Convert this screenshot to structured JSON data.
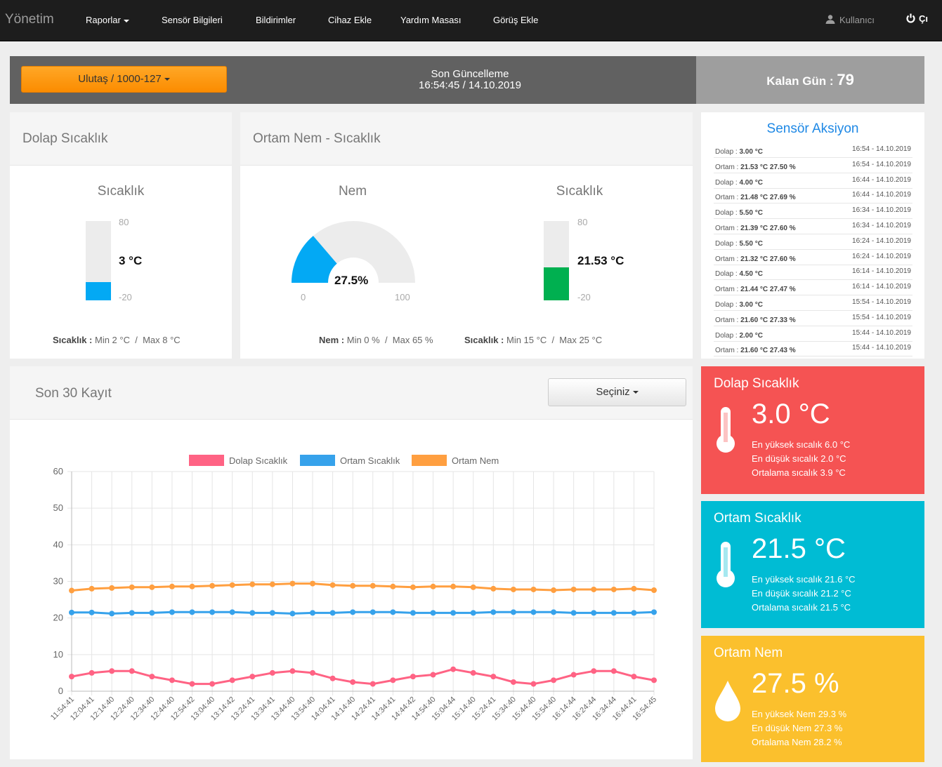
{
  "nav": {
    "brand": "Yönetim",
    "items": [
      "Raporlar",
      "Sensör Bilgileri",
      "Bildirimler",
      "Cihaz Ekle",
      "Yardım Masası",
      "Görüş Ekle"
    ],
    "user": "Kullanıcı",
    "logout": "Çı"
  },
  "topbar": {
    "device": "Ulutaş / 1000-127",
    "update_label": "Son Güncelleme",
    "update_time": "16:54:45 / 14.10.2019",
    "days_label": "Kalan Gün :",
    "days_value": "79"
  },
  "dolap_panel": {
    "title": "Dolap Sıcaklık",
    "gauge_title": "Sıcaklık",
    "value": "3 °C",
    "level": 0.23,
    "max": "80",
    "min": "-20",
    "minmax": {
      "label": "Sıcaklık :",
      "min": "Min 2 °C",
      "max": "Max 8 °C"
    }
  },
  "ortam_panel": {
    "title": "Ortam Nem - Sıcaklık",
    "nem": {
      "title": "Nem",
      "value": "27.5%",
      "fraction": 0.275,
      "min": "0",
      "max": "100",
      "minmax": {
        "label": "Nem :",
        "min": "Min 0 %",
        "max": "Max 65 %"
      }
    },
    "sicaklik": {
      "title": "Sıcaklık",
      "value": "21.53 °C",
      "level": 0.415,
      "max": "80",
      "min": "-20",
      "minmax": {
        "label": "Sıcaklık :",
        "min": "Min 15 °C",
        "max": "Max 25 °C"
      }
    }
  },
  "actions": {
    "title": "Sensör Aksiyon",
    "rows": [
      {
        "label": "Dolap :",
        "value": "3.00 °C",
        "time": "16:54 - 14.10.2019"
      },
      {
        "label": "Ortam :",
        "value": "21.53 °C 27.50 %",
        "time": "16:54 - 14.10.2019"
      },
      {
        "label": "Dolap :",
        "value": "4.00 °C",
        "time": "16:44 - 14.10.2019"
      },
      {
        "label": "Ortam :",
        "value": "21.48 °C 27.69 %",
        "time": "16:44 - 14.10.2019"
      },
      {
        "label": "Dolap :",
        "value": "5.50 °C",
        "time": "16:34 - 14.10.2019"
      },
      {
        "label": "Ortam :",
        "value": "21.39 °C 27.60 %",
        "time": "16:34 - 14.10.2019"
      },
      {
        "label": "Dolap :",
        "value": "5.50 °C",
        "time": "16:24 - 14.10.2019"
      },
      {
        "label": "Ortam :",
        "value": "21.32 °C 27.60 %",
        "time": "16:24 - 14.10.2019"
      },
      {
        "label": "Dolap :",
        "value": "4.50 °C",
        "time": "16:14 - 14.10.2019"
      },
      {
        "label": "Ortam :",
        "value": "21.44 °C 27.47 %",
        "time": "16:14 - 14.10.2019"
      },
      {
        "label": "Dolap :",
        "value": "3.00 °C",
        "time": "15:54 - 14.10.2019"
      },
      {
        "label": "Ortam :",
        "value": "21.60 °C 27.33 %",
        "time": "15:54 - 14.10.2019"
      },
      {
        "label": "Dolap :",
        "value": "2.00 °C",
        "time": "15:44 - 14.10.2019"
      },
      {
        "label": "Ortam :",
        "value": "21.60 °C 27.43 %",
        "time": "15:44 - 14.10.2019"
      }
    ]
  },
  "cards": {
    "dolap": {
      "title": "Dolap Sıcaklık",
      "value": "3.0 °C",
      "stats": [
        "En yüksek sıcalık  6.0 °C",
        "En düşük sıcalık   2.0 °C",
        "Ortalama sıcalık   3.9 °C"
      ],
      "color": "#f55353",
      "icon": "thermometer-icon"
    },
    "ortam": {
      "title": "Ortam Sıcaklık",
      "value": "21.5 °C",
      "stats": [
        "En yüksek sıcalık  21.6 °C",
        "En düşük sıcalık   21.2 °C",
        "Ortalama sıcalık   21.5 °C"
      ],
      "color": "#00bcd4",
      "icon": "thermometer-icon"
    },
    "nem": {
      "title": "Ortam Nem",
      "value": "27.5 %",
      "stats": [
        "En yüksek Nem  29.3 %",
        "En düşük Nem   27.3 %",
        "Ortalama Nem   28.2 %"
      ],
      "color": "#fbc02d",
      "icon": "water-drop-icon"
    }
  },
  "chart_panel": {
    "title": "Son 30 Kayıt",
    "select_label": "Seçiniz"
  },
  "chart_data": {
    "type": "line",
    "categories": [
      "11:54:41",
      "12:04:41",
      "12:14:40",
      "12:24:40",
      "12:34:40",
      "12:44:40",
      "12:54:42",
      "13:04:40",
      "13:14:42",
      "13:24:41",
      "13:34:41",
      "13:44:40",
      "13:54:40",
      "14:04:41",
      "14:14:40",
      "14:24:41",
      "14:34:41",
      "14:44:42",
      "14:54:40",
      "15:04:44",
      "15:14:40",
      "15:24:41",
      "15:34:40",
      "15:44:40",
      "15:54:40",
      "16:14:44",
      "16:24:44",
      "16:34:44",
      "16:44:41",
      "16:54:45"
    ],
    "series": [
      {
        "name": "Dolap Sıcaklık",
        "color": "#ff6384",
        "values": [
          4,
          5,
          5.5,
          5.5,
          4,
          3,
          2,
          2,
          3,
          4,
          5,
          5.5,
          5,
          3.5,
          2.5,
          2,
          3,
          4,
          4.5,
          6,
          5,
          4,
          2.5,
          2,
          3,
          4.5,
          5.5,
          5.5,
          4,
          3
        ]
      },
      {
        "name": "Ortam Sıcaklık",
        "color": "#36a2eb",
        "values": [
          21.5,
          21.5,
          21.2,
          21.4,
          21.4,
          21.6,
          21.6,
          21.6,
          21.6,
          21.4,
          21.4,
          21.2,
          21.4,
          21.4,
          21.6,
          21.6,
          21.6,
          21.4,
          21.4,
          21.4,
          21.4,
          21.6,
          21.6,
          21.6,
          21.6,
          21.4,
          21.4,
          21.4,
          21.4,
          21.6
        ]
      },
      {
        "name": "Ortam Nem",
        "color": "#ff9f40",
        "values": [
          27.5,
          28,
          28.2,
          28.4,
          28.4,
          28.6,
          28.6,
          28.8,
          29,
          29.2,
          29.2,
          29.4,
          29.4,
          29,
          28.8,
          28.8,
          28.6,
          28.4,
          28.6,
          28.6,
          28.4,
          28,
          27.8,
          27.8,
          27.6,
          27.8,
          27.8,
          27.8,
          28,
          27.6
        ]
      }
    ],
    "ylim": [
      0,
      60
    ],
    "yticks": [
      0,
      10,
      20,
      30,
      40,
      50,
      60
    ],
    "legend": "top",
    "grid": true
  }
}
